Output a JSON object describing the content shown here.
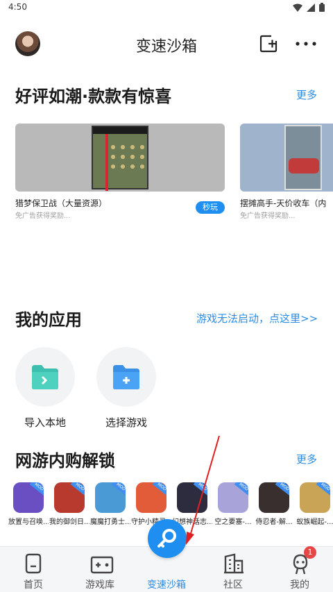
{
  "status_bar": {
    "time": "4:50"
  },
  "header": {
    "title": "变速沙箱"
  },
  "featured": {
    "title": "好评如潮·款款有惊喜",
    "more_label": "更多",
    "games": [
      {
        "name": "猎梦保卫战（大量资源）",
        "subtitle": "免广告获得奖励...",
        "play_label": "秒玩"
      },
      {
        "name": "摆摊高手-天价收车（内",
        "subtitle": "免广告获得奖励..."
      }
    ]
  },
  "my_apps": {
    "title": "我的应用",
    "help_link": "游戏无法启动，点这里>>",
    "tiles": [
      {
        "label": "导入本地",
        "icon": "folder-import-icon"
      },
      {
        "label": "选择游戏",
        "icon": "folder-add-icon"
      }
    ]
  },
  "unlock": {
    "title": "网游内购解锁",
    "more_label": "更多",
    "games": [
      {
        "label": "放置与召唤...",
        "color": "#6a4fc2"
      },
      {
        "label": "我的御剑日...",
        "color": "#b83a2f"
      },
      {
        "label": "魔魔打勇士...",
        "color": "#4a9ad6"
      },
      {
        "label": "守护小精灵...",
        "color": "#e25c3a"
      },
      {
        "label": "幻想神话志...",
        "color": "#2d2b3e"
      },
      {
        "label": "空之要塞-...",
        "color": "#a8a3d8"
      },
      {
        "label": "侍忍者-解...",
        "color": "#3a2f2f"
      },
      {
        "label": "蚁族崛起-...",
        "color": "#c9a457"
      }
    ]
  },
  "bottom_nav": {
    "items": [
      {
        "label": "首页",
        "icon": "home-icon"
      },
      {
        "label": "游戏库",
        "icon": "gamepad-icon"
      },
      {
        "label": "变速沙箱",
        "icon": "key-icon"
      },
      {
        "label": "社区",
        "icon": "building-icon"
      },
      {
        "label": "我的",
        "icon": "profile-icon"
      }
    ],
    "badge": "1"
  },
  "colors": {
    "accent": "#2a8ce5",
    "button": "#1e8ef0",
    "badge": "#e74646",
    "annotation_arrow": "#e02020"
  }
}
